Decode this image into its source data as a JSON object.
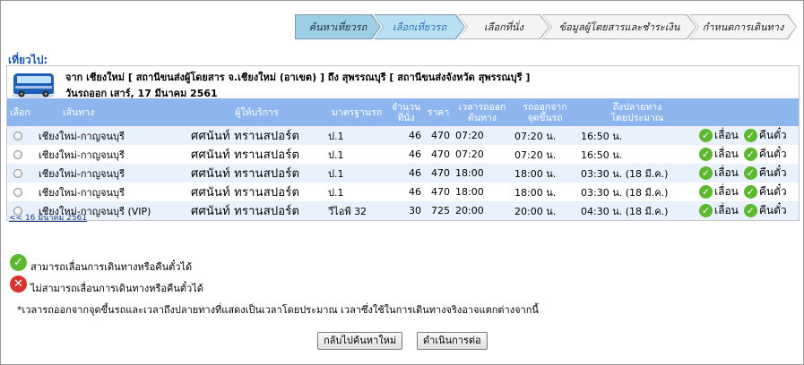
{
  "steps": [
    {
      "label": "ค้นหาเที่ยวรถ"
    },
    {
      "label": "เลือกเที่ยวรถ"
    },
    {
      "label": "เลือกที่นั่ง"
    },
    {
      "label": "ข้อมูลผู้โดยสารและชำระเงิน"
    },
    {
      "label": "กำหนดการเดินทาง"
    }
  ],
  "trip": {
    "heading": "เที่ยวไป:",
    "route": "จาก เชียงใหม่ [ สถานีขนส่งผู้โดยสาร จ.เชียงใหม่ (อาเขต) ] ถึง สุพรรณบุรี [ สถานีขนส่งจังหวัด สุพรรณบุรี ]",
    "date": "วันรถออก เสาร์, 17 มีนาคม 2561",
    "bus_icon": "bus-icon"
  },
  "table": {
    "headers": {
      "select": "เลือก",
      "route": "เส้นทาง",
      "operator": "ผู้ให้บริการ",
      "standard": "มาตรฐานรถ",
      "seats_l1": "จำนวน",
      "seats_l2": "ที่นั่ง",
      "price": "ราคา",
      "dep_l1": "เวลารถออก",
      "dep_l2": "ต้นทาง",
      "board_l1": "รถออกจาก",
      "board_l2": "จุดขึ้นรถ",
      "arr_l1": "ถึงปลายทาง",
      "arr_l2": "โดยประมาณ"
    },
    "rows": [
      {
        "route": "เชียงใหม่-กาญจนบุรี",
        "operator": "ศศนันท์ ทรานสปอร์ต",
        "standard": "ป.1",
        "seats": "46",
        "price": "470",
        "departure": "07:20",
        "boarding": "07:20 น.",
        "arrival": "16:50 น.",
        "action1": "เลื่อน",
        "action2": "คืนตั๋ว"
      },
      {
        "route": "เชียงใหม่-กาญจนบุรี",
        "operator": "ศศนันท์ ทรานสปอร์ต",
        "standard": "ป.1",
        "seats": "46",
        "price": "470",
        "departure": "07:20",
        "boarding": "07:20 น.",
        "arrival": "16:50 น.",
        "action1": "เลื่อน",
        "action2": "คืนตั๋ว"
      },
      {
        "route": "เชียงใหม่-กาญจนบุรี",
        "operator": "ศศนันท์ ทรานสปอร์ต",
        "standard": "ป.1",
        "seats": "46",
        "price": "470",
        "departure": "18:00",
        "boarding": "18:00 น.",
        "arrival": "03:30 น. (18 มี.ค.)",
        "action1": "เลื่อน",
        "action2": "คืนตั๋ว"
      },
      {
        "route": "เชียงใหม่-กาญจนบุรี",
        "operator": "ศศนันท์ ทรานสปอร์ต",
        "standard": "ป.1",
        "seats": "46",
        "price": "470",
        "departure": "18:00",
        "boarding": "18:00 น.",
        "arrival": "03:30 น. (18 มี.ค.)",
        "action1": "เลื่อน",
        "action2": "คืนตั๋ว"
      },
      {
        "route": "เชียงใหม่-กาญจนบุรี (VIP)",
        "operator": "ศศนันท์ ทรานสปอร์ต",
        "standard": "วีไอพี 32",
        "seats": "30",
        "price": "725",
        "departure": "20:00",
        "boarding": "20:00 น.",
        "arrival": "04:30 น. (18 มี.ค.)",
        "action1": "เลื่อน",
        "action2": "คืนตั๋ว"
      }
    ],
    "prev_link": "<< 16 มีนาคม 2561"
  },
  "legend": {
    "can": "สามารถเลื่อนการเดินทางหรือคืนตั๋วได้",
    "cannot": "ไม่สามารถเลื่อนการเดินทางหรือคืนตั๋วได้",
    "note": "*เวลารถออกจากจุดขึ้นรถและเวลาถึงปลายทางที่แสดงเป็นเวลาโดยประมาณ เวลาซึ่งใช้ในการเดินทางจริงอาจแตกต่างจากนี้"
  },
  "buttons": {
    "back": "กลับไปค้นหาใหม่",
    "next": "ดำเนินการต่อ"
  },
  "colors": {
    "header_blue": "#8db6ef",
    "row_alt": "#e8f1fc",
    "ok_green": "#5cb82e",
    "no_red": "#d9342b",
    "active_step": "#9ccfe5"
  }
}
